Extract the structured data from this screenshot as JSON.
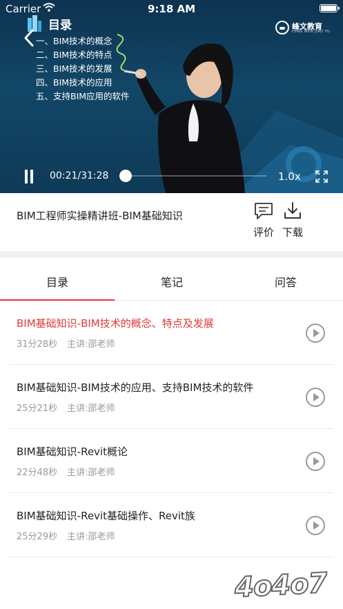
{
  "status_bar": {
    "carrier": "Carrier",
    "time": "9:18 AM"
  },
  "video": {
    "slide_title": "目录",
    "slide_items": [
      "一、BIM技术的概念",
      "二、BIM技术的特点",
      "三、BIM技术的发展",
      "四、BIM技术的应用",
      "五、支持BIM应用的软件"
    ],
    "brand_name": "峰文教育",
    "brand_sub": "FENG WEN JIAO YU",
    "time_readout": "00:21/31:28",
    "progress": 0.011,
    "speed": "1.0x"
  },
  "course": {
    "title": "BIM工程师实操精讲班-BIM基础知识"
  },
  "actions": {
    "review_label": "评价",
    "download_label": "下载"
  },
  "tabs": [
    {
      "label": "目录"
    },
    {
      "label": "笔记"
    },
    {
      "label": "问答"
    }
  ],
  "active_tab": 0,
  "lessons": [
    {
      "title": "BIM基础知识-BIM技术的概念、特点及发展",
      "duration": "31分28秒",
      "teacher": "主讲:邵老师",
      "active": true
    },
    {
      "title": "BIM基础知识-BIM技术的应用、支持BIM技术的软件",
      "duration": "25分21秒",
      "teacher": "主讲:邵老师",
      "active": false
    },
    {
      "title": "BIM基础知识-Revit概论",
      "duration": "22分48秒",
      "teacher": "主讲:邵老师",
      "active": false
    },
    {
      "title": "BIM基础知识-Revit基础操作、Revit族",
      "duration": "25分29秒",
      "teacher": "主讲:邵老师",
      "active": false
    }
  ],
  "watermark": "4o4o7",
  "colors": {
    "accent": "#e03b36",
    "video_bg": "#124767"
  }
}
